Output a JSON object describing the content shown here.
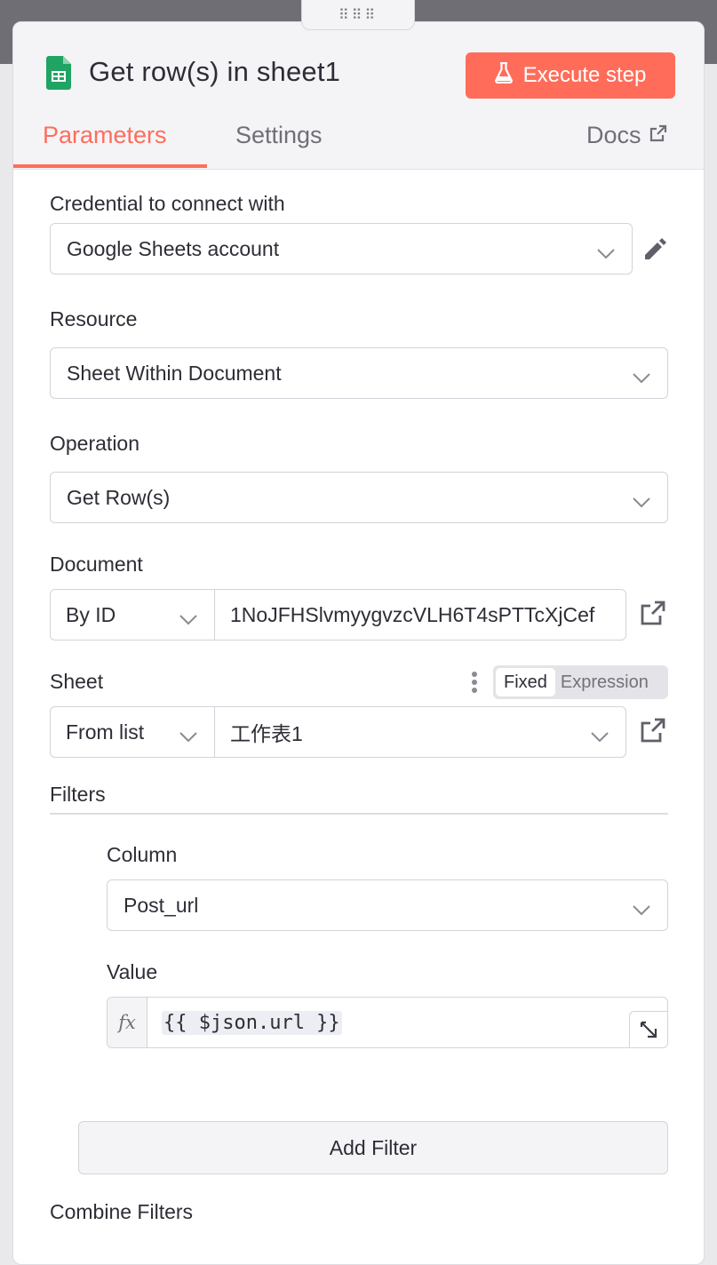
{
  "header": {
    "node_title": "Get row(s) in sheet1",
    "execute_label": "Execute step",
    "drag_handle": "⠿⠿⠿"
  },
  "tabs": {
    "parameters": "Parameters",
    "settings": "Settings",
    "docs": "Docs"
  },
  "fields": {
    "credential": {
      "label": "Credential to connect with",
      "value": "Google Sheets account"
    },
    "resource": {
      "label": "Resource",
      "value": "Sheet Within Document"
    },
    "operation": {
      "label": "Operation",
      "value": "Get Row(s)"
    },
    "document": {
      "label": "Document",
      "mode": "By ID",
      "value": "1NoJFHSlvmyygvzcVLH6T4sPTTcXjCef"
    },
    "sheet": {
      "label": "Sheet",
      "mode": "From list",
      "value": "工作表1",
      "toggle_fixed": "Fixed",
      "toggle_expression": "Expression"
    }
  },
  "filters": {
    "title": "Filters",
    "column": {
      "label": "Column",
      "value": "Post_url"
    },
    "value": {
      "label": "Value",
      "fx": "fx",
      "expression": "{{ $json.url }}"
    },
    "add_button": "Add Filter"
  },
  "cut_off_label": "Combine Filters",
  "colors": {
    "accent": "#ff6d5a",
    "sheets_green": "#20a464"
  }
}
